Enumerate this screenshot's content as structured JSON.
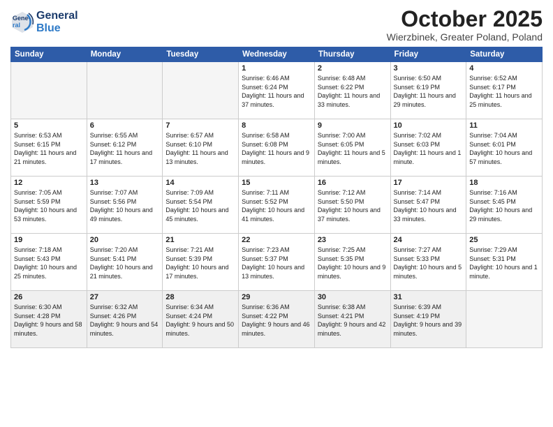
{
  "header": {
    "logo_line1": "General",
    "logo_line2": "Blue",
    "month": "October 2025",
    "location": "Wierzbinek, Greater Poland, Poland"
  },
  "weekdays": [
    "Sunday",
    "Monday",
    "Tuesday",
    "Wednesday",
    "Thursday",
    "Friday",
    "Saturday"
  ],
  "weeks": [
    [
      {
        "day": "",
        "sunrise": "",
        "sunset": "",
        "daylight": ""
      },
      {
        "day": "",
        "sunrise": "",
        "sunset": "",
        "daylight": ""
      },
      {
        "day": "",
        "sunrise": "",
        "sunset": "",
        "daylight": ""
      },
      {
        "day": "1",
        "sunrise": "Sunrise: 6:46 AM",
        "sunset": "Sunset: 6:24 PM",
        "daylight": "Daylight: 11 hours and 37 minutes."
      },
      {
        "day": "2",
        "sunrise": "Sunrise: 6:48 AM",
        "sunset": "Sunset: 6:22 PM",
        "daylight": "Daylight: 11 hours and 33 minutes."
      },
      {
        "day": "3",
        "sunrise": "Sunrise: 6:50 AM",
        "sunset": "Sunset: 6:19 PM",
        "daylight": "Daylight: 11 hours and 29 minutes."
      },
      {
        "day": "4",
        "sunrise": "Sunrise: 6:52 AM",
        "sunset": "Sunset: 6:17 PM",
        "daylight": "Daylight: 11 hours and 25 minutes."
      }
    ],
    [
      {
        "day": "5",
        "sunrise": "Sunrise: 6:53 AM",
        "sunset": "Sunset: 6:15 PM",
        "daylight": "Daylight: 11 hours and 21 minutes."
      },
      {
        "day": "6",
        "sunrise": "Sunrise: 6:55 AM",
        "sunset": "Sunset: 6:12 PM",
        "daylight": "Daylight: 11 hours and 17 minutes."
      },
      {
        "day": "7",
        "sunrise": "Sunrise: 6:57 AM",
        "sunset": "Sunset: 6:10 PM",
        "daylight": "Daylight: 11 hours and 13 minutes."
      },
      {
        "day": "8",
        "sunrise": "Sunrise: 6:58 AM",
        "sunset": "Sunset: 6:08 PM",
        "daylight": "Daylight: 11 hours and 9 minutes."
      },
      {
        "day": "9",
        "sunrise": "Sunrise: 7:00 AM",
        "sunset": "Sunset: 6:05 PM",
        "daylight": "Daylight: 11 hours and 5 minutes."
      },
      {
        "day": "10",
        "sunrise": "Sunrise: 7:02 AM",
        "sunset": "Sunset: 6:03 PM",
        "daylight": "Daylight: 11 hours and 1 minute."
      },
      {
        "day": "11",
        "sunrise": "Sunrise: 7:04 AM",
        "sunset": "Sunset: 6:01 PM",
        "daylight": "Daylight: 10 hours and 57 minutes."
      }
    ],
    [
      {
        "day": "12",
        "sunrise": "Sunrise: 7:05 AM",
        "sunset": "Sunset: 5:59 PM",
        "daylight": "Daylight: 10 hours and 53 minutes."
      },
      {
        "day": "13",
        "sunrise": "Sunrise: 7:07 AM",
        "sunset": "Sunset: 5:56 PM",
        "daylight": "Daylight: 10 hours and 49 minutes."
      },
      {
        "day": "14",
        "sunrise": "Sunrise: 7:09 AM",
        "sunset": "Sunset: 5:54 PM",
        "daylight": "Daylight: 10 hours and 45 minutes."
      },
      {
        "day": "15",
        "sunrise": "Sunrise: 7:11 AM",
        "sunset": "Sunset: 5:52 PM",
        "daylight": "Daylight: 10 hours and 41 minutes."
      },
      {
        "day": "16",
        "sunrise": "Sunrise: 7:12 AM",
        "sunset": "Sunset: 5:50 PM",
        "daylight": "Daylight: 10 hours and 37 minutes."
      },
      {
        "day": "17",
        "sunrise": "Sunrise: 7:14 AM",
        "sunset": "Sunset: 5:47 PM",
        "daylight": "Daylight: 10 hours and 33 minutes."
      },
      {
        "day": "18",
        "sunrise": "Sunrise: 7:16 AM",
        "sunset": "Sunset: 5:45 PM",
        "daylight": "Daylight: 10 hours and 29 minutes."
      }
    ],
    [
      {
        "day": "19",
        "sunrise": "Sunrise: 7:18 AM",
        "sunset": "Sunset: 5:43 PM",
        "daylight": "Daylight: 10 hours and 25 minutes."
      },
      {
        "day": "20",
        "sunrise": "Sunrise: 7:20 AM",
        "sunset": "Sunset: 5:41 PM",
        "daylight": "Daylight: 10 hours and 21 minutes."
      },
      {
        "day": "21",
        "sunrise": "Sunrise: 7:21 AM",
        "sunset": "Sunset: 5:39 PM",
        "daylight": "Daylight: 10 hours and 17 minutes."
      },
      {
        "day": "22",
        "sunrise": "Sunrise: 7:23 AM",
        "sunset": "Sunset: 5:37 PM",
        "daylight": "Daylight: 10 hours and 13 minutes."
      },
      {
        "day": "23",
        "sunrise": "Sunrise: 7:25 AM",
        "sunset": "Sunset: 5:35 PM",
        "daylight": "Daylight: 10 hours and 9 minutes."
      },
      {
        "day": "24",
        "sunrise": "Sunrise: 7:27 AM",
        "sunset": "Sunset: 5:33 PM",
        "daylight": "Daylight: 10 hours and 5 minutes."
      },
      {
        "day": "25",
        "sunrise": "Sunrise: 7:29 AM",
        "sunset": "Sunset: 5:31 PM",
        "daylight": "Daylight: 10 hours and 1 minute."
      }
    ],
    [
      {
        "day": "26",
        "sunrise": "Sunrise: 6:30 AM",
        "sunset": "Sunset: 4:28 PM",
        "daylight": "Daylight: 9 hours and 58 minutes."
      },
      {
        "day": "27",
        "sunrise": "Sunrise: 6:32 AM",
        "sunset": "Sunset: 4:26 PM",
        "daylight": "Daylight: 9 hours and 54 minutes."
      },
      {
        "day": "28",
        "sunrise": "Sunrise: 6:34 AM",
        "sunset": "Sunset: 4:24 PM",
        "daylight": "Daylight: 9 hours and 50 minutes."
      },
      {
        "day": "29",
        "sunrise": "Sunrise: 6:36 AM",
        "sunset": "Sunset: 4:22 PM",
        "daylight": "Daylight: 9 hours and 46 minutes."
      },
      {
        "day": "30",
        "sunrise": "Sunrise: 6:38 AM",
        "sunset": "Sunset: 4:21 PM",
        "daylight": "Daylight: 9 hours and 42 minutes."
      },
      {
        "day": "31",
        "sunrise": "Sunrise: 6:39 AM",
        "sunset": "Sunset: 4:19 PM",
        "daylight": "Daylight: 9 hours and 39 minutes."
      },
      {
        "day": "",
        "sunrise": "",
        "sunset": "",
        "daylight": ""
      }
    ]
  ]
}
